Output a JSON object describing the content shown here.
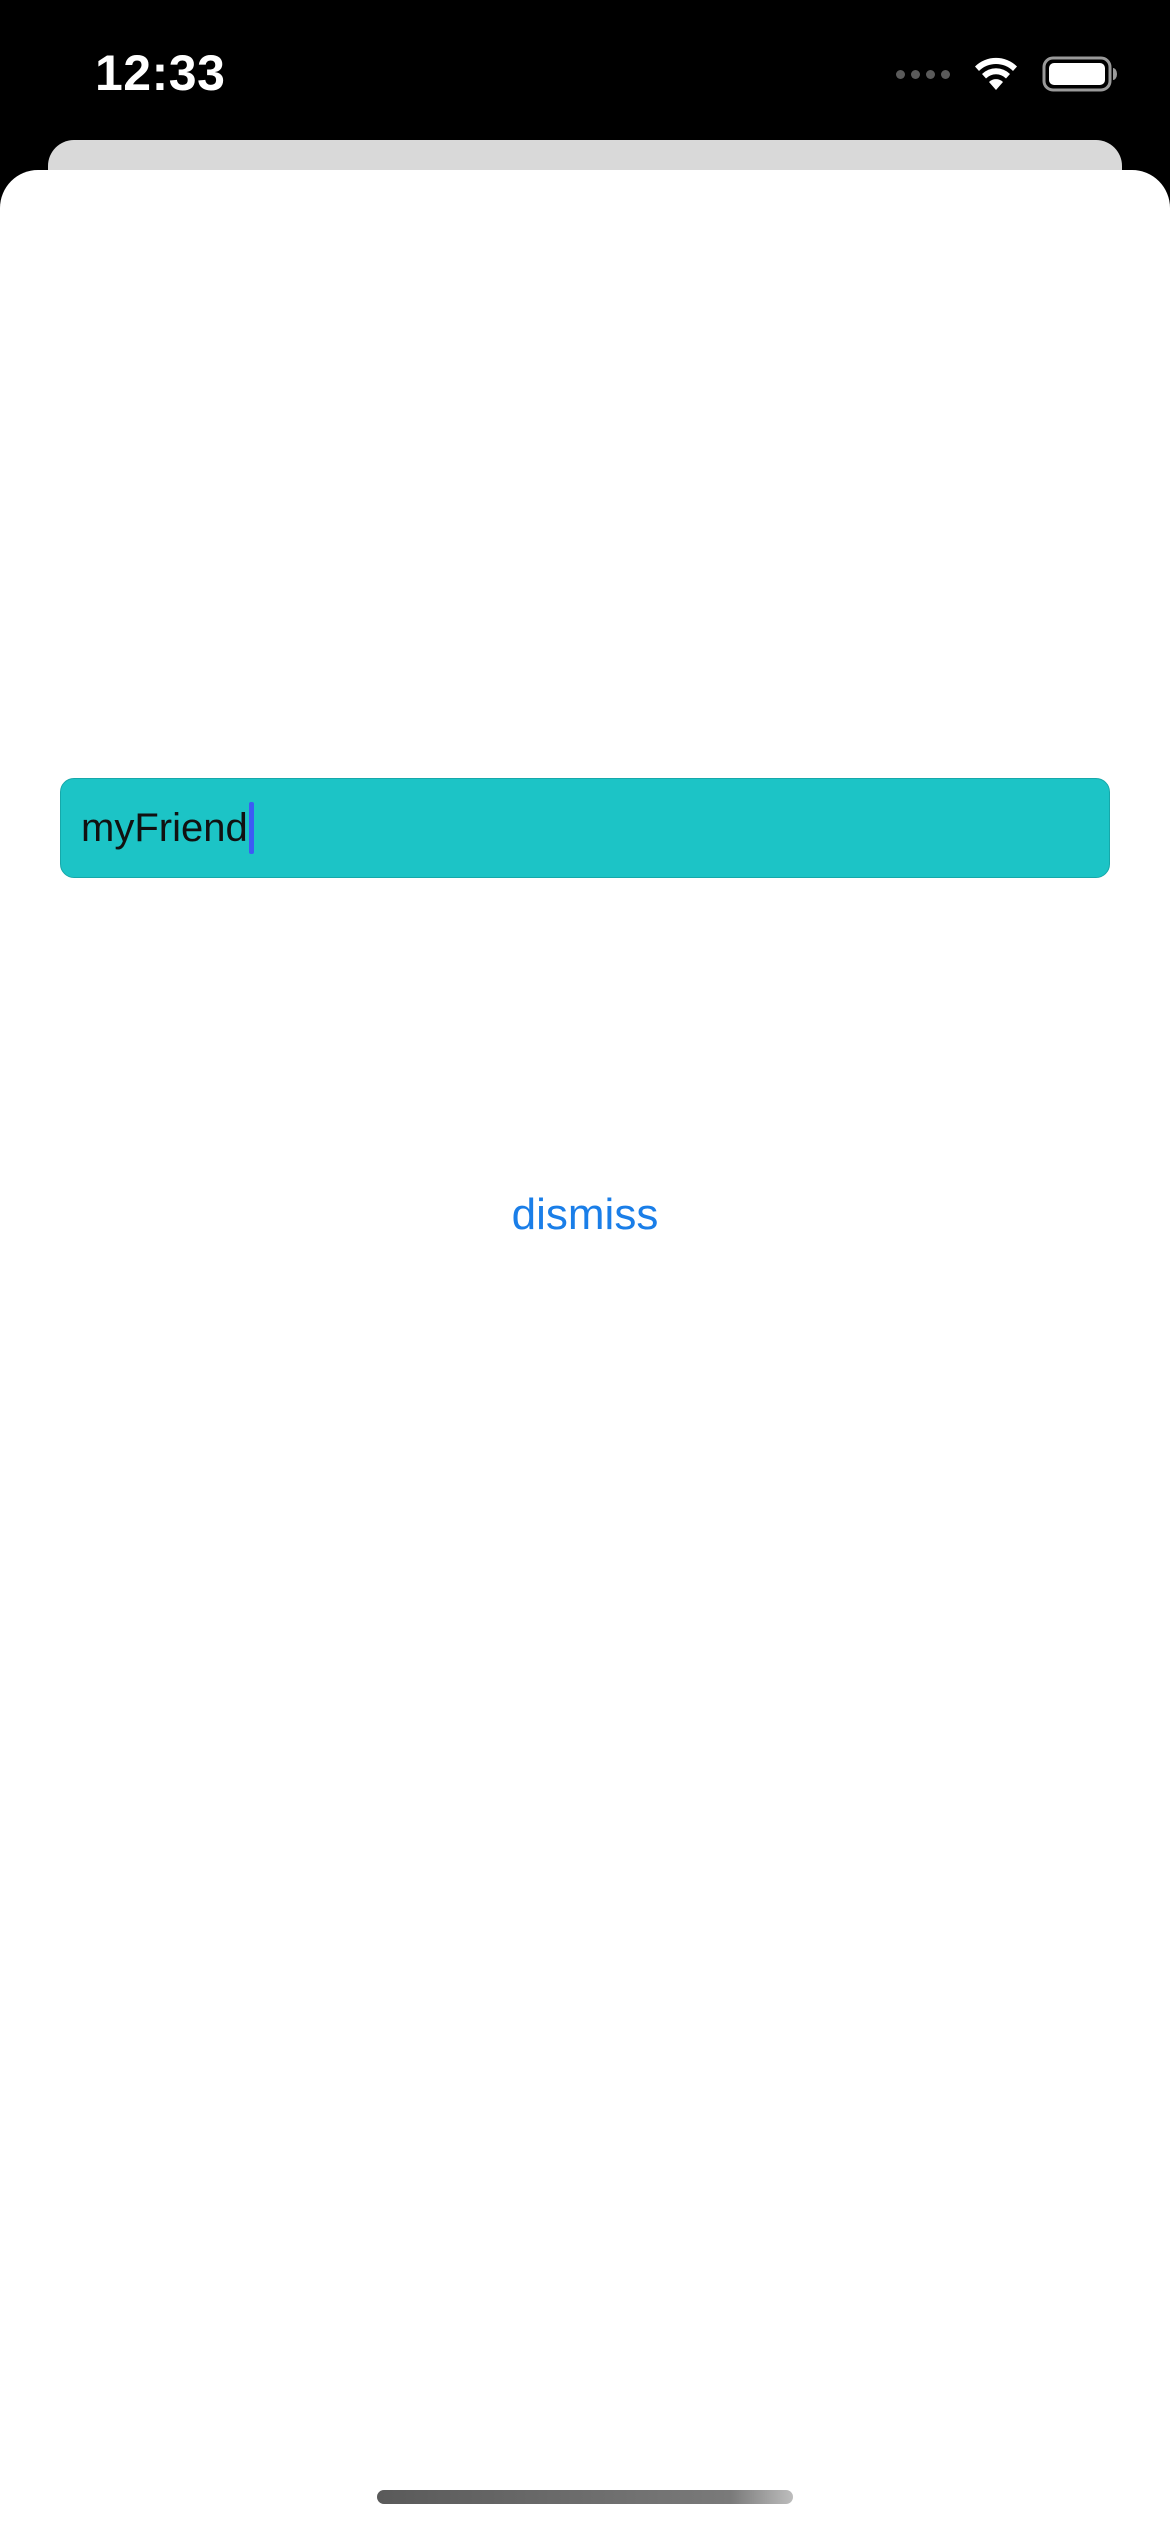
{
  "status_bar": {
    "time": "12:33",
    "icons": [
      "signal-icon",
      "wifi-icon",
      "battery-icon"
    ]
  },
  "text_field": {
    "value": "myFriend",
    "background_color": "#1cc4c6",
    "caret_color": "#3d5bf5"
  },
  "dismiss_button": {
    "label": "dismiss",
    "color": "#1a7ee8"
  }
}
